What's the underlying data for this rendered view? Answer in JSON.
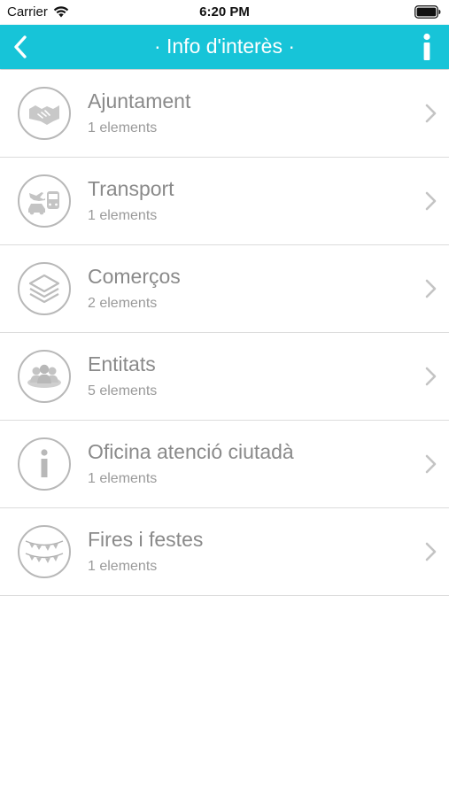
{
  "status_bar": {
    "carrier": "Carrier",
    "time": "6:20 PM"
  },
  "nav": {
    "title": "· Info d'interès ·",
    "back_icon": "chevron-left-icon",
    "info_icon": "info-icon",
    "color": "#17c4d8"
  },
  "list": {
    "items": [
      {
        "title": "Ajuntament",
        "subtitle": "1 elements",
        "icon": "handshake-icon"
      },
      {
        "title": "Transport",
        "subtitle": "1 elements",
        "icon": "transport-icon"
      },
      {
        "title": "Comerços",
        "subtitle": "2 elements",
        "icon": "layers-icon"
      },
      {
        "title": "Entitats",
        "subtitle": "5 elements",
        "icon": "group-icon"
      },
      {
        "title": "Oficina atenció ciutadà",
        "subtitle": "1 elements",
        "icon": "info-circle-icon"
      },
      {
        "title": "Fires i festes",
        "subtitle": "1 elements",
        "icon": "bunting-icon"
      }
    ]
  }
}
